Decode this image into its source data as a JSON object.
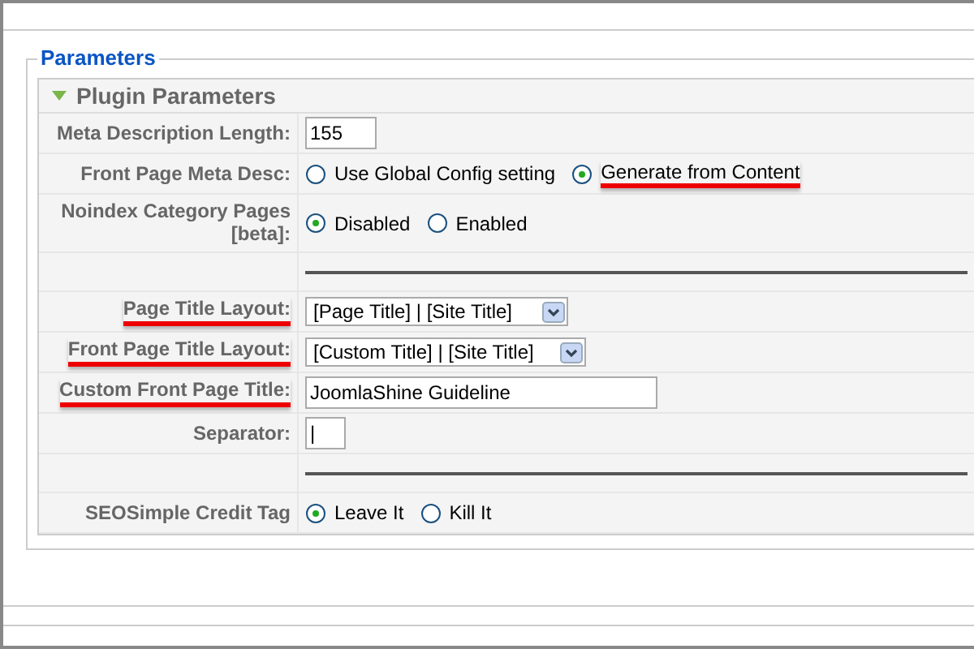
{
  "fieldset": {
    "legend": "Parameters"
  },
  "panel": {
    "title": "Plugin Parameters",
    "expanded": true,
    "rows": [
      {
        "kind": "text",
        "label": "Meta Description Length:",
        "underlined": false,
        "value": "155"
      },
      {
        "kind": "radio",
        "label": "Front Page Meta Desc:",
        "underlined": false,
        "options": [
          {
            "label": "Use Global Config setting",
            "selected": false,
            "underlined": false
          },
          {
            "label": "Generate from Content",
            "selected": true,
            "underlined": true
          }
        ]
      },
      {
        "kind": "radio",
        "label": "Noindex Category Pages [beta]:",
        "underlined": false,
        "options": [
          {
            "label": "Disabled",
            "selected": true,
            "underlined": false
          },
          {
            "label": "Enabled",
            "selected": false,
            "underlined": false
          }
        ]
      },
      {
        "kind": "rule"
      },
      {
        "kind": "select",
        "label": "Page Title Layout:",
        "underlined": true,
        "value": "[Page Title] | [Site Title]"
      },
      {
        "kind": "select",
        "label": "Front Page Title Layout:",
        "underlined": true,
        "value": "[Custom Title] | [Site Title]"
      },
      {
        "kind": "text",
        "label": "Custom Front Page Title:",
        "underlined": true,
        "value": "JoomlaShine Guideline"
      },
      {
        "kind": "text",
        "label": "Separator:",
        "underlined": false,
        "value": "|"
      },
      {
        "kind": "rule"
      },
      {
        "kind": "radio",
        "label": "SEOSimple Credit Tag",
        "underlined": false,
        "options": [
          {
            "label": "Leave It",
            "selected": true,
            "underlined": false
          },
          {
            "label": "Kill It",
            "selected": false,
            "underlined": false
          }
        ]
      }
    ]
  }
}
